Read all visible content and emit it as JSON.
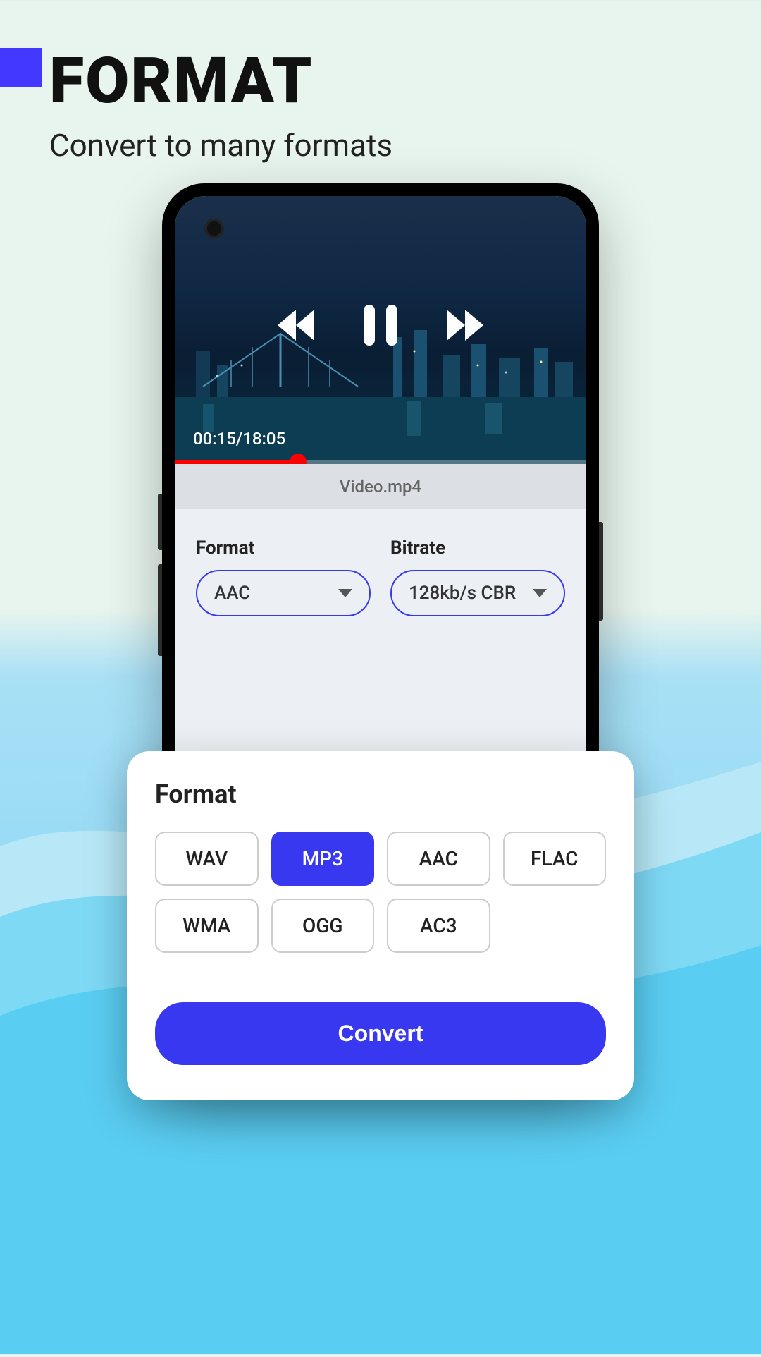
{
  "header": {
    "title": "FORMAT",
    "subtitle": "Convert to many formats"
  },
  "video": {
    "currentTime": "00:15",
    "duration": "18:05",
    "filename": "Video.mp4"
  },
  "dropdowns": {
    "format": {
      "label": "Format",
      "value": "AAC"
    },
    "bitrate": {
      "label": "Bitrate",
      "value": "128kb/s CBR"
    }
  },
  "sheet": {
    "title": "Format",
    "options": [
      {
        "label": "WAV",
        "active": false
      },
      {
        "label": "MP3",
        "active": true
      },
      {
        "label": "AAC",
        "active": false
      },
      {
        "label": "FLAC",
        "active": false
      },
      {
        "label": "WMA",
        "active": false
      },
      {
        "label": "OGG",
        "active": false
      },
      {
        "label": "AC3",
        "active": false
      }
    ],
    "button": "Convert"
  },
  "colors": {
    "accent": "#3838f0",
    "progress": "#ff0000"
  }
}
